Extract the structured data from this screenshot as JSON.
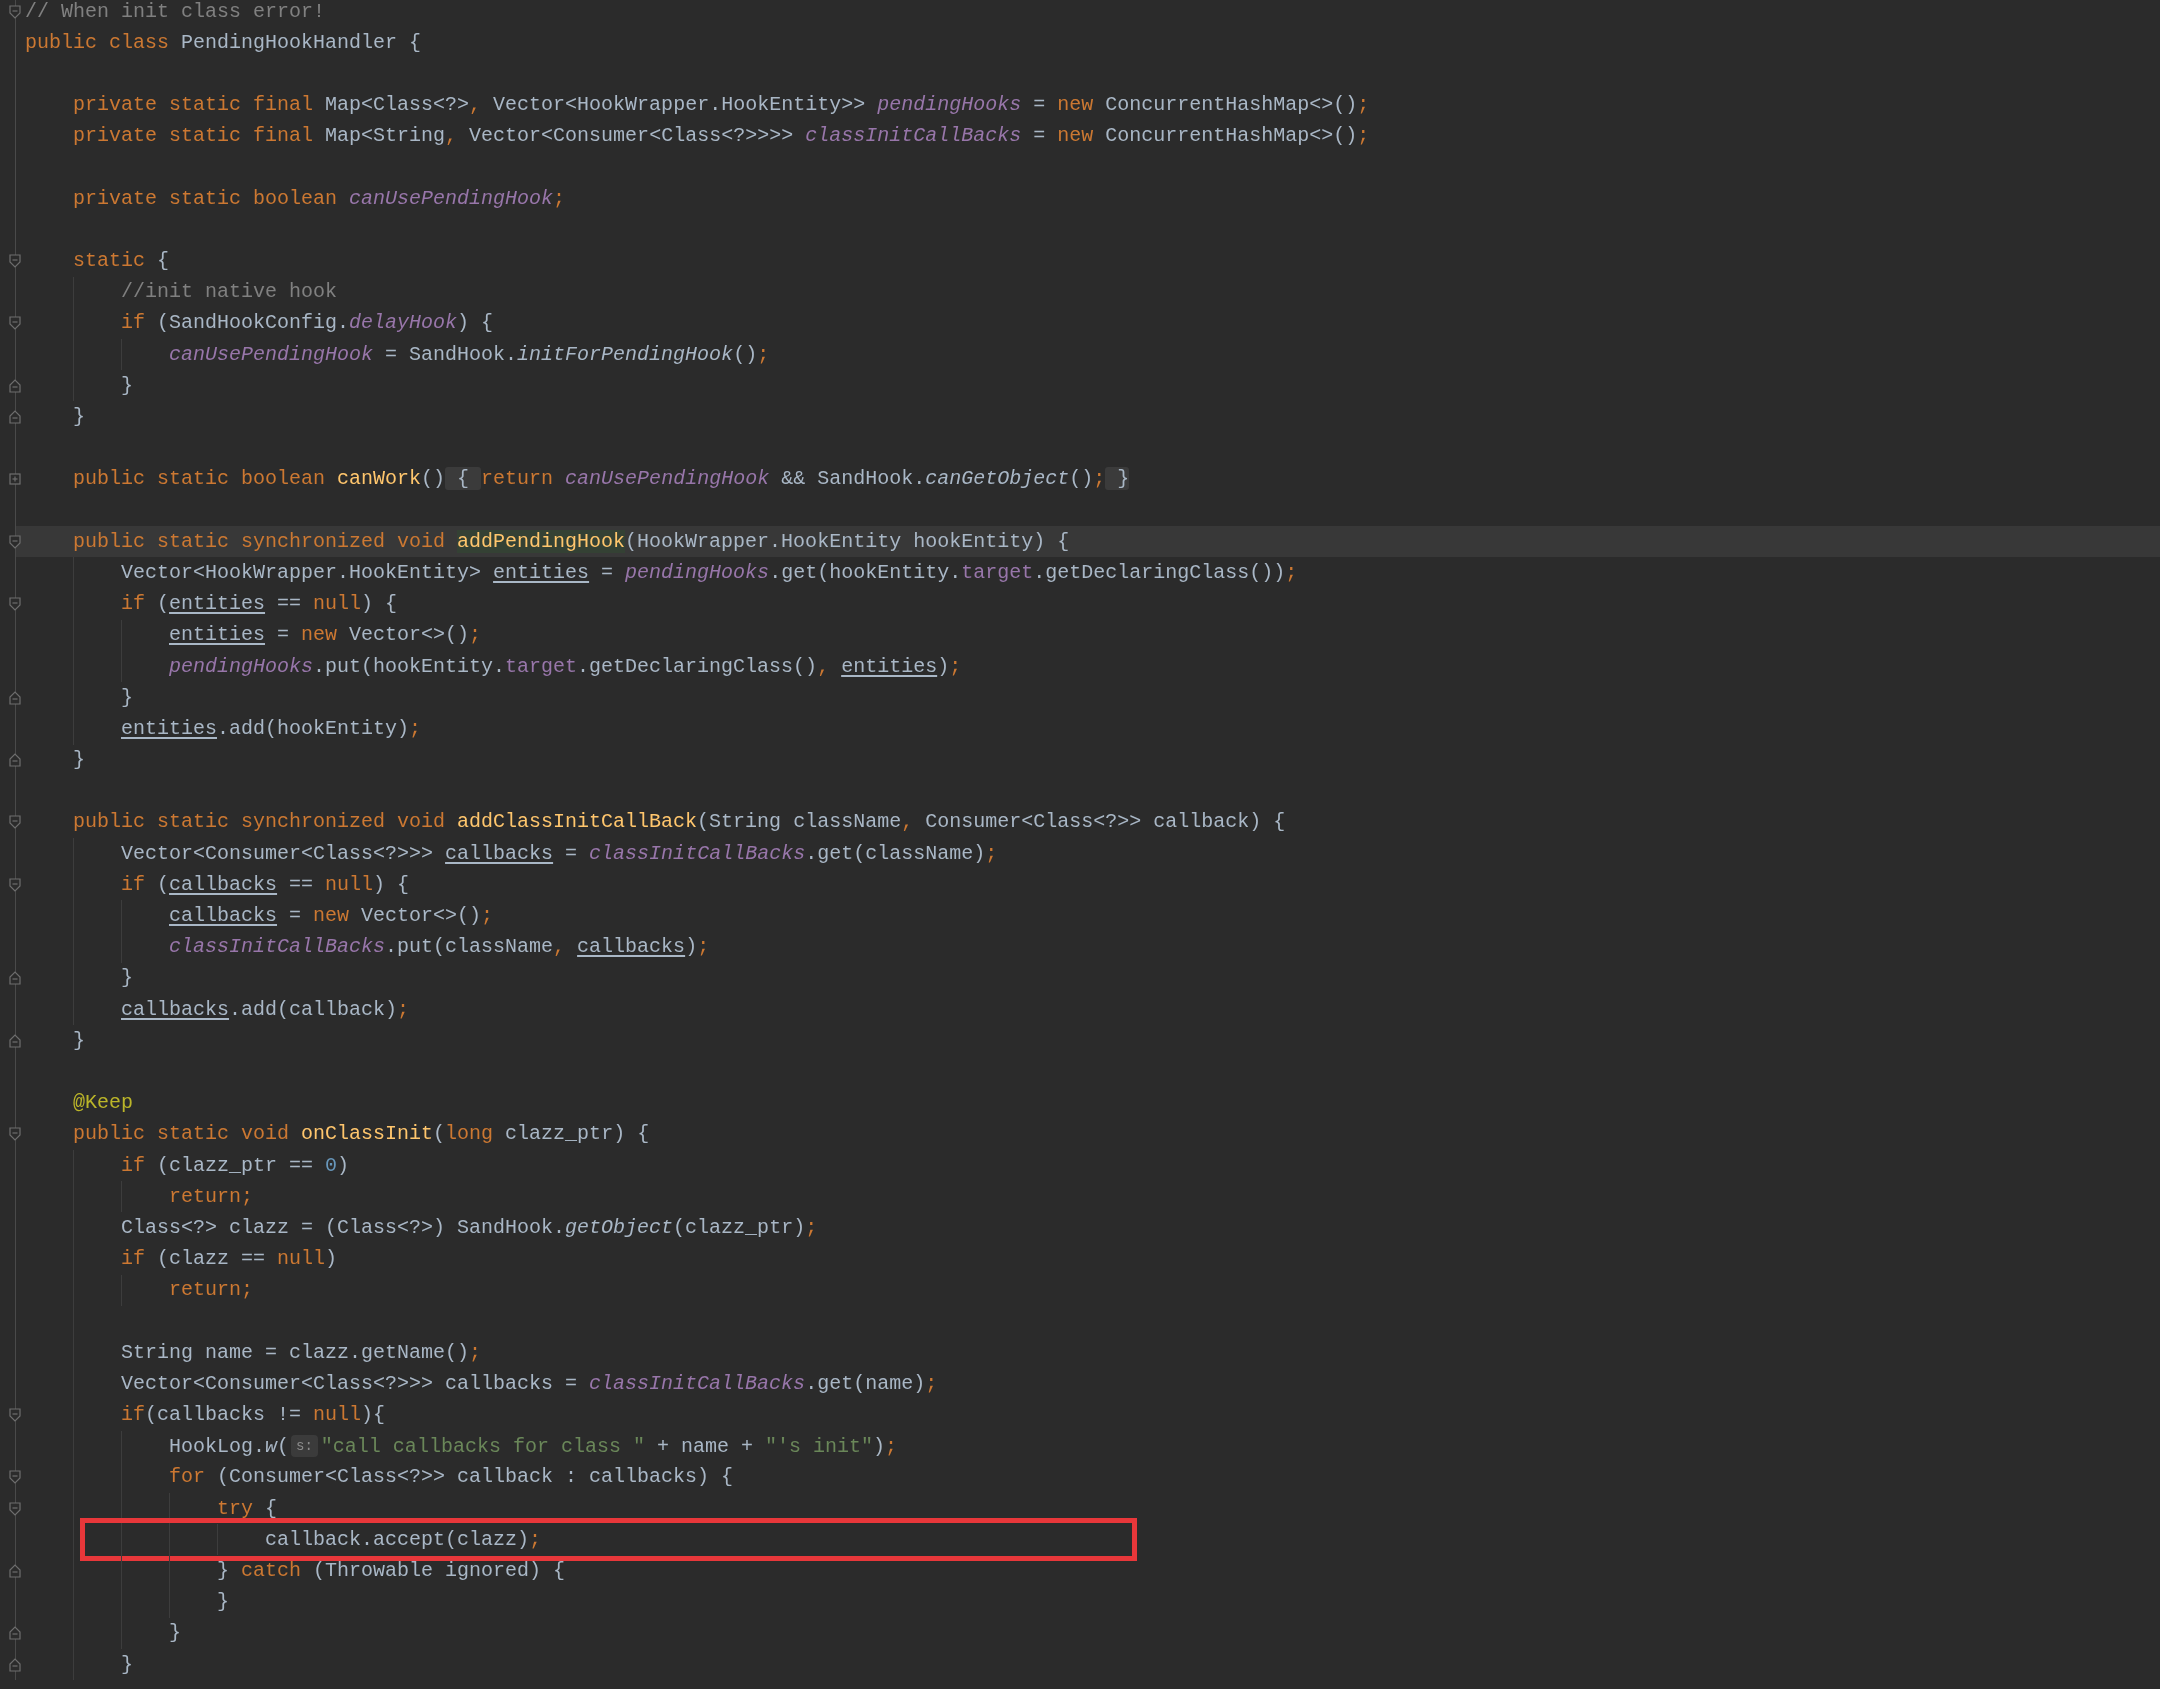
{
  "editor": {
    "lines": [
      {
        "kind": "code",
        "fold": {
          "kind": "open"
        },
        "current": false,
        "boxed": false,
        "tokens": [
          {
            "kind": "comment",
            "text": "// When init class error!"
          }
        ]
      },
      {
        "kind": "code",
        "current": false,
        "boxed": false,
        "tokens": [
          {
            "kind": "kw",
            "text": "public class "
          },
          {
            "kind": "plain",
            "text": "PendingHookHandler {"
          }
        ],
        "children": [
          {
            "kind": "blank"
          },
          {
            "kind": "code",
            "current": false,
            "boxed": false,
            "tokens": [
              {
                "kind": "kw",
                "text": "private static final "
              },
              {
                "kind": "plain",
                "text": "Map<Class<?>"
              },
              {
                "kind": "kw",
                "text": ","
              },
              {
                "kind": "plain",
                "text": " Vector<HookWrapper.HookEntity>> "
              },
              {
                "kind": "field",
                "text": "pendingHooks"
              },
              {
                "kind": "plain",
                "text": " = "
              },
              {
                "kind": "kw",
                "text": "new "
              },
              {
                "kind": "plain",
                "text": "ConcurrentHashMap<>()"
              },
              {
                "kind": "kw",
                "text": ";"
              }
            ]
          },
          {
            "kind": "code",
            "current": false,
            "boxed": false,
            "tokens": [
              {
                "kind": "kw",
                "text": "private static final "
              },
              {
                "kind": "plain",
                "text": "Map<String"
              },
              {
                "kind": "kw",
                "text": ","
              },
              {
                "kind": "plain",
                "text": " Vector<Consumer<Class<?>>>> "
              },
              {
                "kind": "field",
                "text": "classInitCallBacks"
              },
              {
                "kind": "plain",
                "text": " = "
              },
              {
                "kind": "kw",
                "text": "new "
              },
              {
                "kind": "plain",
                "text": "ConcurrentHashMap<>()"
              },
              {
                "kind": "kw",
                "text": ";"
              }
            ]
          },
          {
            "kind": "blank"
          },
          {
            "kind": "code",
            "current": false,
            "boxed": false,
            "tokens": [
              {
                "kind": "kw",
                "text": "private static boolean "
              },
              {
                "kind": "field",
                "text": "canUsePendingHook"
              },
              {
                "kind": "kw",
                "text": ";"
              }
            ]
          },
          {
            "kind": "blank"
          },
          {
            "kind": "code",
            "fold": {
              "kind": "open"
            },
            "current": false,
            "boxed": false,
            "tokens": [
              {
                "kind": "kw",
                "text": "static "
              },
              {
                "kind": "plain",
                "text": "{"
              }
            ],
            "children": [
              {
                "kind": "code",
                "current": false,
                "boxed": false,
                "tokens": [
                  {
                    "kind": "comment",
                    "text": "//init native hook"
                  }
                ]
              },
              {
                "kind": "code",
                "fold": {
                  "kind": "open"
                },
                "current": false,
                "boxed": false,
                "tokens": [
                  {
                    "kind": "kw",
                    "text": "if "
                  },
                  {
                    "kind": "plain",
                    "text": "(SandHookConfig."
                  },
                  {
                    "kind": "field",
                    "text": "delayHook"
                  },
                  {
                    "kind": "plain",
                    "text": ") {"
                  }
                ],
                "children": [
                  {
                    "kind": "code",
                    "current": false,
                    "boxed": false,
                    "tokens": [
                      {
                        "kind": "field",
                        "text": "canUsePendingHook"
                      },
                      {
                        "kind": "plain",
                        "text": " = SandHook."
                      },
                      {
                        "kind": "static",
                        "text": "initForPendingHook"
                      },
                      {
                        "kind": "plain",
                        "text": "()"
                      },
                      {
                        "kind": "kw",
                        "text": ";"
                      }
                    ]
                  }
                ]
              },
              {
                "kind": "code",
                "fold": {
                  "kind": "close"
                },
                "current": false,
                "boxed": false,
                "tokens": [
                  {
                    "kind": "plain",
                    "text": "}"
                  }
                ]
              }
            ]
          },
          {
            "kind": "code",
            "fold": {
              "kind": "close"
            },
            "current": false,
            "boxed": false,
            "tokens": [
              {
                "kind": "plain",
                "text": "}"
              }
            ]
          },
          {
            "kind": "blank"
          },
          {
            "kind": "code",
            "fold": {
              "kind": "collapsed"
            },
            "current": false,
            "boxed": false,
            "tokens": [
              {
                "kind": "kw",
                "text": "public static boolean "
              },
              {
                "kind": "decl",
                "text": "canWork"
              },
              {
                "kind": "plain",
                "text": "()"
              },
              {
                "kind": "folded",
                "text": " { "
              },
              {
                "kind": "kw",
                "text": "return "
              },
              {
                "kind": "field",
                "text": "canUsePendingHook"
              },
              {
                "kind": "plain",
                "text": " && SandHook."
              },
              {
                "kind": "static",
                "text": "canGetObject"
              },
              {
                "kind": "plain",
                "text": "()"
              },
              {
                "kind": "kw",
                "text": ";"
              },
              {
                "kind": "folded",
                "text": " }"
              }
            ]
          },
          {
            "kind": "blank"
          },
          {
            "kind": "code",
            "fold": {
              "kind": "open"
            },
            "current": true,
            "boxed": false,
            "tokens": [
              {
                "kind": "kw",
                "text": "public static synchronized void "
              },
              {
                "kind": "decl-hl",
                "text": "addPendingHook"
              },
              {
                "kind": "plain",
                "text": "(HookWrapper.HookEntity hookEntity) {"
              }
            ],
            "children": [
              {
                "kind": "code",
                "current": false,
                "boxed": false,
                "tokens": [
                  {
                    "kind": "plain",
                    "text": "Vector<HookWrapper.HookEntity> "
                  },
                  {
                    "kind": "local",
                    "text": "entities"
                  },
                  {
                    "kind": "plain",
                    "text": " = "
                  },
                  {
                    "kind": "field",
                    "text": "pendingHooks"
                  },
                  {
                    "kind": "plain",
                    "text": ".get(hookEntity."
                  },
                  {
                    "kind": "ifield",
                    "text": "target"
                  },
                  {
                    "kind": "plain",
                    "text": ".getDeclaringClass())"
                  },
                  {
                    "kind": "kw",
                    "text": ";"
                  }
                ]
              },
              {
                "kind": "code",
                "fold": {
                  "kind": "open"
                },
                "current": false,
                "boxed": false,
                "tokens": [
                  {
                    "kind": "kw",
                    "text": "if "
                  },
                  {
                    "kind": "plain",
                    "text": "("
                  },
                  {
                    "kind": "local",
                    "text": "entities"
                  },
                  {
                    "kind": "plain",
                    "text": " == "
                  },
                  {
                    "kind": "kw",
                    "text": "null"
                  },
                  {
                    "kind": "plain",
                    "text": ") {"
                  }
                ],
                "children": [
                  {
                    "kind": "code",
                    "current": false,
                    "boxed": false,
                    "tokens": [
                      {
                        "kind": "local",
                        "text": "entities"
                      },
                      {
                        "kind": "plain",
                        "text": " = "
                      },
                      {
                        "kind": "kw",
                        "text": "new "
                      },
                      {
                        "kind": "plain",
                        "text": "Vector<>()"
                      },
                      {
                        "kind": "kw",
                        "text": ";"
                      }
                    ]
                  },
                  {
                    "kind": "code",
                    "current": false,
                    "boxed": false,
                    "tokens": [
                      {
                        "kind": "field",
                        "text": "pendingHooks"
                      },
                      {
                        "kind": "plain",
                        "text": ".put(hookEntity."
                      },
                      {
                        "kind": "ifield",
                        "text": "target"
                      },
                      {
                        "kind": "plain",
                        "text": ".getDeclaringClass()"
                      },
                      {
                        "kind": "kw",
                        "text": ", "
                      },
                      {
                        "kind": "local",
                        "text": "entities"
                      },
                      {
                        "kind": "plain",
                        "text": ")"
                      },
                      {
                        "kind": "kw",
                        "text": ";"
                      }
                    ]
                  }
                ]
              },
              {
                "kind": "code",
                "fold": {
                  "kind": "close"
                },
                "current": false,
                "boxed": false,
                "tokens": [
                  {
                    "kind": "plain",
                    "text": "}"
                  }
                ]
              },
              {
                "kind": "code",
                "current": false,
                "boxed": false,
                "tokens": [
                  {
                    "kind": "local",
                    "text": "entities"
                  },
                  {
                    "kind": "plain",
                    "text": ".add(hookEntity)"
                  },
                  {
                    "kind": "kw",
                    "text": ";"
                  }
                ]
              }
            ]
          },
          {
            "kind": "code",
            "fold": {
              "kind": "close"
            },
            "current": false,
            "boxed": false,
            "tokens": [
              {
                "kind": "plain",
                "text": "}"
              }
            ]
          },
          {
            "kind": "blank"
          },
          {
            "kind": "code",
            "fold": {
              "kind": "open"
            },
            "current": false,
            "boxed": false,
            "tokens": [
              {
                "kind": "kw",
                "text": "public static synchronized void "
              },
              {
                "kind": "decl",
                "text": "addClassInitCallBack"
              },
              {
                "kind": "plain",
                "text": "(String className"
              },
              {
                "kind": "kw",
                "text": ", "
              },
              {
                "kind": "plain",
                "text": "Consumer<Class<?>> callback) {"
              }
            ],
            "children": [
              {
                "kind": "code",
                "current": false,
                "boxed": false,
                "tokens": [
                  {
                    "kind": "plain",
                    "text": "Vector<Consumer<Class<?>>> "
                  },
                  {
                    "kind": "local",
                    "text": "callbacks"
                  },
                  {
                    "kind": "plain",
                    "text": " = "
                  },
                  {
                    "kind": "field",
                    "text": "classInitCallBacks"
                  },
                  {
                    "kind": "plain",
                    "text": ".get(className)"
                  },
                  {
                    "kind": "kw",
                    "text": ";"
                  }
                ]
              },
              {
                "kind": "code",
                "fold": {
                  "kind": "open"
                },
                "current": false,
                "boxed": false,
                "tokens": [
                  {
                    "kind": "kw",
                    "text": "if "
                  },
                  {
                    "kind": "plain",
                    "text": "("
                  },
                  {
                    "kind": "local",
                    "text": "callbacks"
                  },
                  {
                    "kind": "plain",
                    "text": " == "
                  },
                  {
                    "kind": "kw",
                    "text": "null"
                  },
                  {
                    "kind": "plain",
                    "text": ") {"
                  }
                ],
                "children": [
                  {
                    "kind": "code",
                    "current": false,
                    "boxed": false,
                    "tokens": [
                      {
                        "kind": "local",
                        "text": "callbacks"
                      },
                      {
                        "kind": "plain",
                        "text": " = "
                      },
                      {
                        "kind": "kw",
                        "text": "new "
                      },
                      {
                        "kind": "plain",
                        "text": "Vector<>()"
                      },
                      {
                        "kind": "kw",
                        "text": ";"
                      }
                    ]
                  },
                  {
                    "kind": "code",
                    "current": false,
                    "boxed": false,
                    "tokens": [
                      {
                        "kind": "field",
                        "text": "classInitCallBacks"
                      },
                      {
                        "kind": "plain",
                        "text": ".put(className"
                      },
                      {
                        "kind": "kw",
                        "text": ", "
                      },
                      {
                        "kind": "local",
                        "text": "callbacks"
                      },
                      {
                        "kind": "plain",
                        "text": ")"
                      },
                      {
                        "kind": "kw",
                        "text": ";"
                      }
                    ]
                  }
                ]
              },
              {
                "kind": "code",
                "fold": {
                  "kind": "close"
                },
                "current": false,
                "boxed": false,
                "tokens": [
                  {
                    "kind": "plain",
                    "text": "}"
                  }
                ]
              },
              {
                "kind": "code",
                "current": false,
                "boxed": false,
                "tokens": [
                  {
                    "kind": "local",
                    "text": "callbacks"
                  },
                  {
                    "kind": "plain",
                    "text": ".add(callback)"
                  },
                  {
                    "kind": "kw",
                    "text": ";"
                  }
                ]
              }
            ]
          },
          {
            "kind": "code",
            "fold": {
              "kind": "close"
            },
            "current": false,
            "boxed": false,
            "tokens": [
              {
                "kind": "plain",
                "text": "}"
              }
            ]
          },
          {
            "kind": "blank"
          },
          {
            "kind": "code",
            "current": false,
            "boxed": false,
            "tokens": [
              {
                "kind": "annot",
                "text": "@Keep"
              }
            ]
          },
          {
            "kind": "code",
            "fold": {
              "kind": "open"
            },
            "current": false,
            "boxed": false,
            "tokens": [
              {
                "kind": "kw",
                "text": "public static void "
              },
              {
                "kind": "decl",
                "text": "onClassInit"
              },
              {
                "kind": "plain",
                "text": "("
              },
              {
                "kind": "kw",
                "text": "long "
              },
              {
                "kind": "plain",
                "text": "clazz_ptr) {"
              }
            ],
            "children": [
              {
                "kind": "code",
                "current": false,
                "boxed": false,
                "tokens": [
                  {
                    "kind": "kw",
                    "text": "if "
                  },
                  {
                    "kind": "plain",
                    "text": "(clazz_ptr == "
                  },
                  {
                    "kind": "num",
                    "text": "0"
                  },
                  {
                    "kind": "plain",
                    "text": ")"
                  }
                ],
                "children": [
                  {
                    "kind": "code",
                    "current": false,
                    "boxed": false,
                    "tokens": [
                      {
                        "kind": "kw",
                        "text": "return;"
                      }
                    ]
                  }
                ]
              },
              {
                "kind": "code",
                "current": false,
                "boxed": false,
                "tokens": [
                  {
                    "kind": "plain",
                    "text": "Class<?> clazz = (Class<?>) SandHook."
                  },
                  {
                    "kind": "static",
                    "text": "getObject"
                  },
                  {
                    "kind": "plain",
                    "text": "(clazz_ptr)"
                  },
                  {
                    "kind": "kw",
                    "text": ";"
                  }
                ]
              },
              {
                "kind": "code",
                "current": false,
                "boxed": false,
                "tokens": [
                  {
                    "kind": "kw",
                    "text": "if "
                  },
                  {
                    "kind": "plain",
                    "text": "(clazz == "
                  },
                  {
                    "kind": "kw",
                    "text": "null"
                  },
                  {
                    "kind": "plain",
                    "text": ")"
                  }
                ],
                "children": [
                  {
                    "kind": "code",
                    "current": false,
                    "boxed": false,
                    "tokens": [
                      {
                        "kind": "kw",
                        "text": "return;"
                      }
                    ]
                  }
                ]
              },
              {
                "kind": "blank"
              },
              {
                "kind": "code",
                "current": false,
                "boxed": false,
                "tokens": [
                  {
                    "kind": "plain",
                    "text": "String name = clazz.getName()"
                  },
                  {
                    "kind": "kw",
                    "text": ";"
                  }
                ]
              },
              {
                "kind": "code",
                "current": false,
                "boxed": false,
                "tokens": [
                  {
                    "kind": "plain",
                    "text": "Vector<Consumer<Class<?>>> callbacks = "
                  },
                  {
                    "kind": "field",
                    "text": "classInitCallBacks"
                  },
                  {
                    "kind": "plain",
                    "text": ".get(name)"
                  },
                  {
                    "kind": "kw",
                    "text": ";"
                  }
                ]
              },
              {
                "kind": "code",
                "fold": {
                  "kind": "open"
                },
                "current": false,
                "boxed": false,
                "tokens": [
                  {
                    "kind": "kw",
                    "text": "if"
                  },
                  {
                    "kind": "plain",
                    "text": "(callbacks != "
                  },
                  {
                    "kind": "kw",
                    "text": "null"
                  },
                  {
                    "kind": "plain",
                    "text": "){"
                  }
                ],
                "children": [
                  {
                    "kind": "code",
                    "current": false,
                    "boxed": false,
                    "tokens": [
                      {
                        "kind": "plain",
                        "text": "HookLog."
                      },
                      {
                        "kind": "static",
                        "text": "w"
                      },
                      {
                        "kind": "plain",
                        "text": "("
                      },
                      {
                        "kind": "hint",
                        "text": "s:"
                      },
                      {
                        "kind": "str",
                        "text": "\"call callbacks for class \""
                      },
                      {
                        "kind": "plain",
                        "text": " + name + "
                      },
                      {
                        "kind": "str",
                        "text": "\"'s init\""
                      },
                      {
                        "kind": "plain",
                        "text": ")"
                      },
                      {
                        "kind": "kw",
                        "text": ";"
                      }
                    ]
                  },
                  {
                    "kind": "code",
                    "fold": {
                      "kind": "open"
                    },
                    "current": false,
                    "boxed": false,
                    "tokens": [
                      {
                        "kind": "kw",
                        "text": "for "
                      },
                      {
                        "kind": "plain",
                        "text": "(Consumer<Class<?>> callback : callbacks) {"
                      }
                    ],
                    "children": [
                      {
                        "kind": "code",
                        "fold": {
                          "kind": "open"
                        },
                        "current": false,
                        "boxed": false,
                        "tokens": [
                          {
                            "kind": "kw",
                            "text": "try "
                          },
                          {
                            "kind": "plain",
                            "text": "{"
                          }
                        ],
                        "children": [
                          {
                            "kind": "code",
                            "current": false,
                            "boxed": true,
                            "tokens": [
                              {
                                "kind": "plain",
                                "text": "callback.accept(clazz)"
                              },
                              {
                                "kind": "kw",
                                "text": ";"
                              }
                            ]
                          }
                        ]
                      },
                      {
                        "kind": "code",
                        "fold": {
                          "kind": "close"
                        },
                        "current": false,
                        "boxed": false,
                        "tokens": [
                          {
                            "kind": "plain",
                            "text": "} "
                          },
                          {
                            "kind": "kw",
                            "text": "catch "
                          },
                          {
                            "kind": "plain",
                            "text": "(Throwable ignored) {"
                          }
                        ]
                      },
                      {
                        "kind": "code",
                        "current": false,
                        "boxed": false,
                        "tokens": [
                          {
                            "kind": "plain",
                            "text": "}"
                          }
                        ]
                      }
                    ]
                  },
                  {
                    "kind": "code",
                    "fold": {
                      "kind": "close"
                    },
                    "current": false,
                    "boxed": false,
                    "tokens": [
                      {
                        "kind": "plain",
                        "text": "}"
                      }
                    ]
                  }
                ]
              },
              {
                "kind": "code",
                "fold": {
                  "kind": "close"
                },
                "current": false,
                "boxed": false,
                "tokens": [
                  {
                    "kind": "plain",
                    "text": "}"
                  }
                ]
              }
            ]
          }
        ]
      }
    ]
  }
}
